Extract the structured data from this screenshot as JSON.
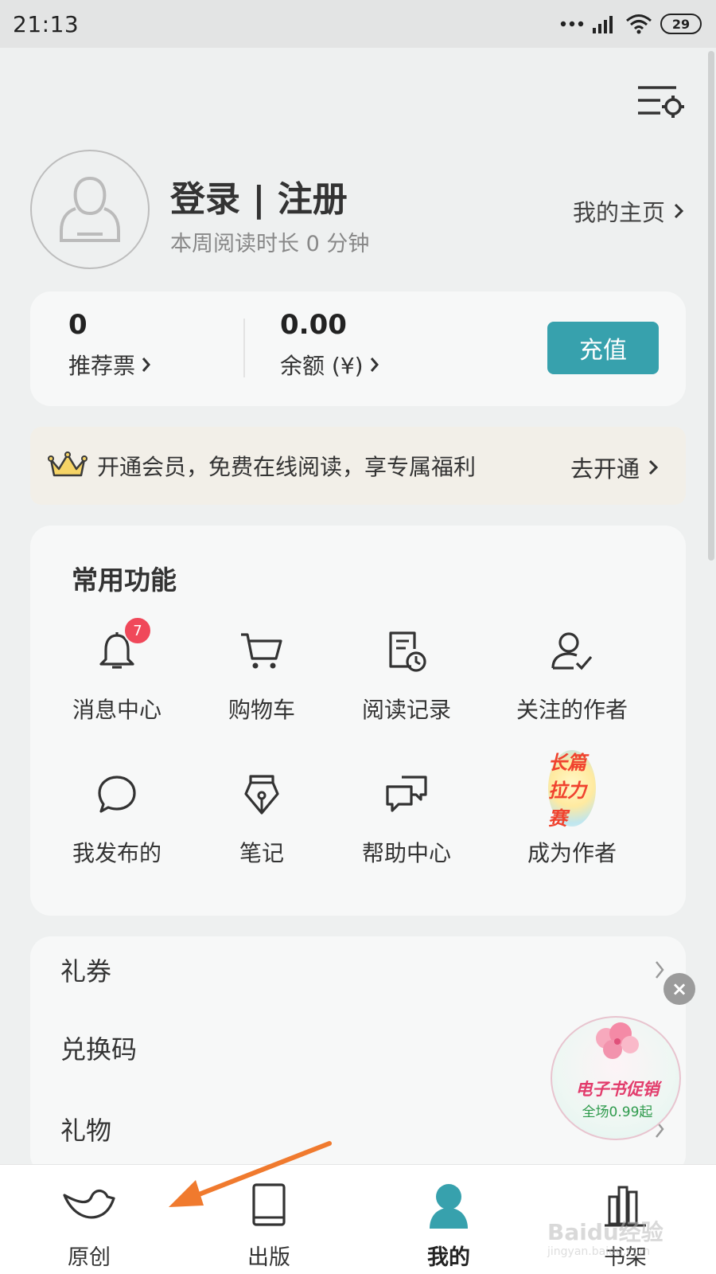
{
  "status_bar": {
    "time": "21:13",
    "battery": "29",
    "icons": [
      "dots-icon",
      "signal-icon",
      "wifi-icon",
      "battery-icon"
    ]
  },
  "header": {
    "settings_icon": "list-settings-icon"
  },
  "profile": {
    "title": "登录 | 注册",
    "read_time": "本周阅读时长 0 分钟",
    "homepage_link": "我的主页"
  },
  "wallet": {
    "tickets_value": "0",
    "tickets_label": "推荐票",
    "balance_value": "0.00",
    "balance_label": "余额 (¥)",
    "recharge_label": "充值"
  },
  "vip_banner": {
    "text": "开通会员，免费在线阅读，享专属福利",
    "action": "去开通"
  },
  "functions": {
    "title": "常用功能",
    "items": [
      {
        "label": "消息中心",
        "icon": "bell-icon",
        "badge": "7"
      },
      {
        "label": "购物车",
        "icon": "cart-icon"
      },
      {
        "label": "阅读记录",
        "icon": "reading-history-icon"
      },
      {
        "label": "关注的作者",
        "icon": "followed-author-icon"
      },
      {
        "label": "我发布的",
        "icon": "chat-bubble-icon"
      },
      {
        "label": "笔记",
        "icon": "pen-nib-icon"
      },
      {
        "label": "帮助中心",
        "icon": "help-chat-icon"
      },
      {
        "label": "成为作者",
        "icon": "author-contest-badge",
        "badge_text": "长篇拉力赛"
      }
    ]
  },
  "menu": {
    "items": [
      "礼券",
      "兑换码",
      "礼物"
    ]
  },
  "promo": {
    "title": "电子书促销",
    "subtitle": "全场0.99起",
    "close": "×"
  },
  "tabbar": {
    "items": [
      {
        "label": "原创",
        "icon": "bird-icon",
        "active": false
      },
      {
        "label": "出版",
        "icon": "book-icon",
        "active": false
      },
      {
        "label": "我的",
        "icon": "person-icon",
        "active": true
      },
      {
        "label": "书架",
        "icon": "bookshelf-icon",
        "active": false
      }
    ]
  },
  "colors": {
    "accent": "#37a1ad",
    "badge": "#f0485a",
    "arrow": "#f07a2e",
    "background": "#eef0f0",
    "card": "#f7f8f8"
  },
  "watermark": {
    "brand": "Baidu经验",
    "url": "jingyan.baidu.com"
  }
}
